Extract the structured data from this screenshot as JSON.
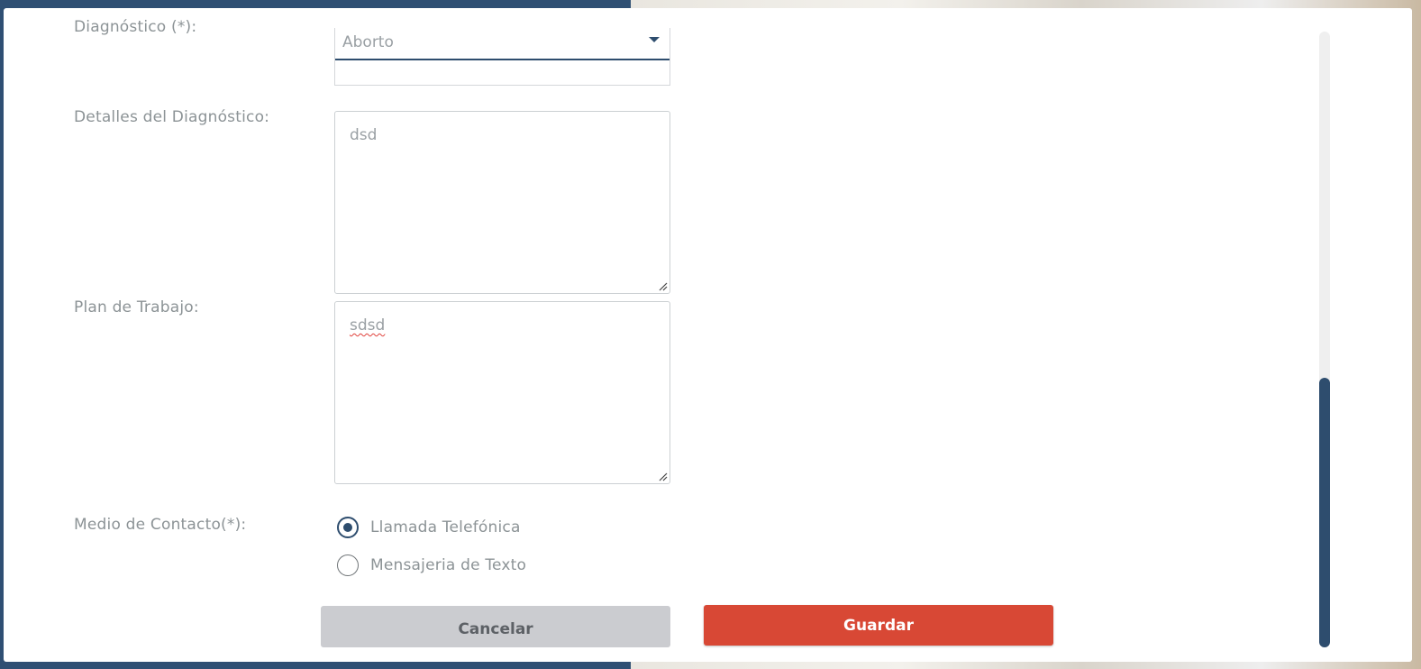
{
  "form": {
    "diagnostico": {
      "label": "Diagnóstico (*):",
      "value": "Aborto"
    },
    "detalles": {
      "label": "Detalles del Diagnóstico:",
      "value": "dsd"
    },
    "plan": {
      "label": "Plan de Trabajo:",
      "value": "sdsd"
    },
    "medio_contacto": {
      "label": "Medio de Contacto(*):",
      "options": [
        {
          "label": "Llamada Telefónica",
          "selected": true
        },
        {
          "label": "Mensajeria de Texto",
          "selected": false
        }
      ]
    }
  },
  "buttons": {
    "cancel_label": "Cancelar",
    "save_label": "Guardar"
  },
  "colors": {
    "primary": "#2e4d6e",
    "save_button": "#d84835",
    "cancel_button": "#cbccd0",
    "label_text": "#8c9396"
  },
  "icons": {
    "dropdown": "caret-down-icon",
    "resize": "resize-handle-icon",
    "radio_checked": "radio-checked-icon",
    "radio_unchecked": "radio-unchecked-icon"
  }
}
